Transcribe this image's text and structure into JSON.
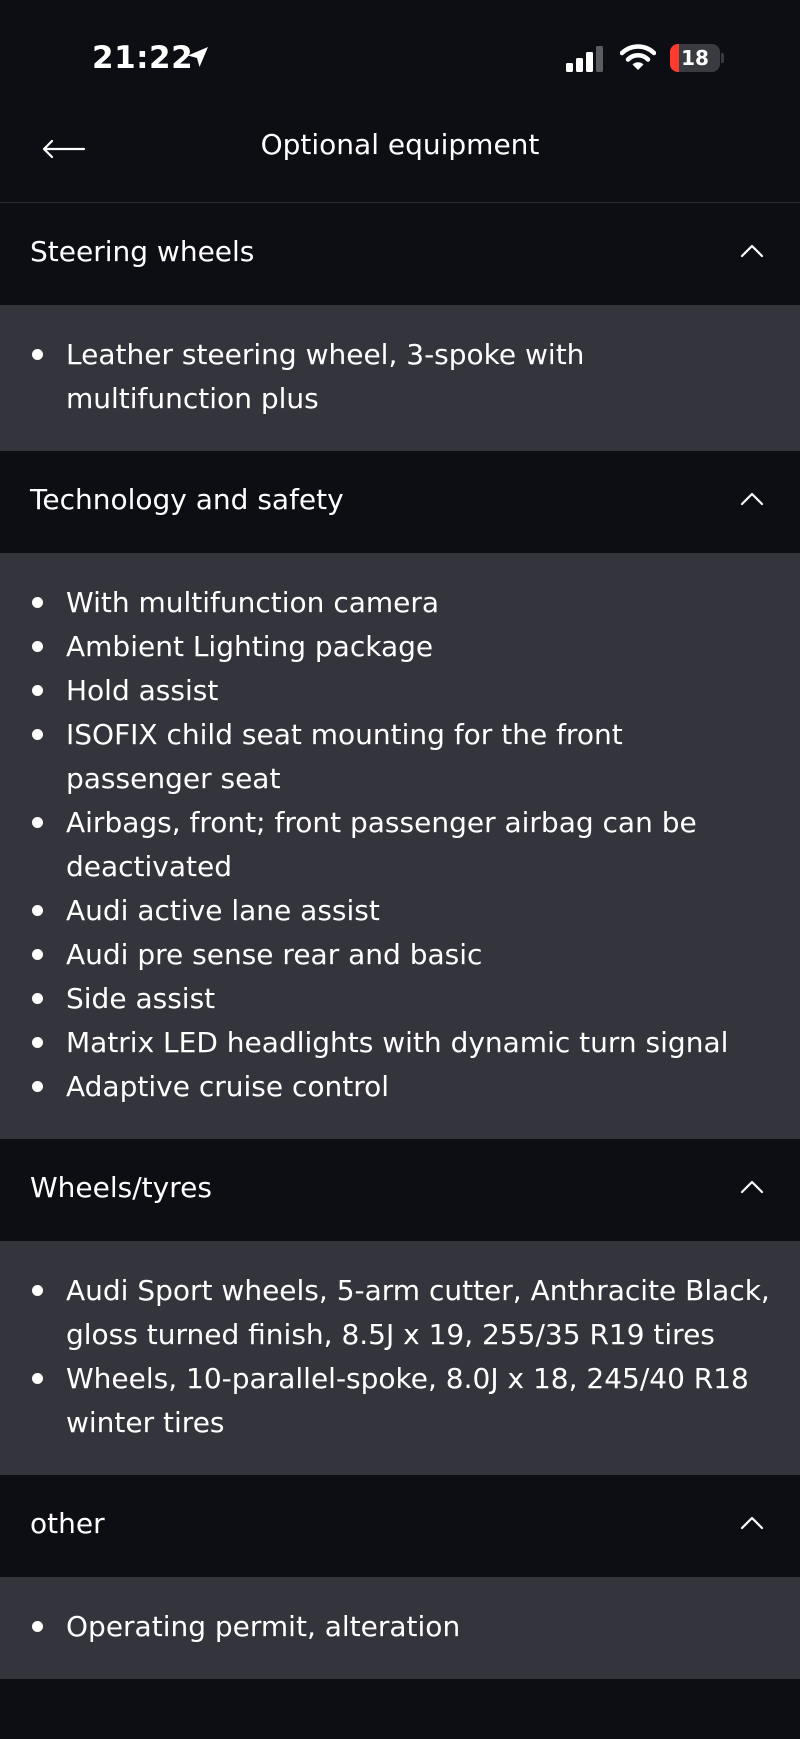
{
  "status_bar": {
    "time": "21:22",
    "battery_level": "18",
    "battery_fraction": 0.18,
    "battery_color": "#ff3b30"
  },
  "header": {
    "title": "Optional equipment"
  },
  "sections": [
    {
      "title": "Steering wheels",
      "items": [
        "Leather steering wheel, 3-spoke with multifunction plus"
      ]
    },
    {
      "title": "Technology and safety",
      "items": [
        "With multifunction camera",
        "Ambient Lighting package",
        "Hold assist",
        "ISOFIX child seat mounting for the front passenger seat",
        "Airbags, front; front passenger airbag can be deactivated",
        "Audi active lane assist",
        "Audi pre sense rear and basic",
        "Side assist",
        "Matrix LED headlights with dynamic turn signal",
        "Adaptive cruise control"
      ]
    },
    {
      "title": "Wheels/tyres",
      "items": [
        "Audi Sport wheels, 5-arm cutter, Anthracite Black, gloss turned finish, 8.5J x 19, 255/35 R19 tires",
        "Wheels, 10-parallel-spoke, 8.0J x 18, 245/40 R18 winter tires"
      ]
    },
    {
      "title": "other",
      "items": [
        "Operating permit, alteration"
      ]
    }
  ]
}
